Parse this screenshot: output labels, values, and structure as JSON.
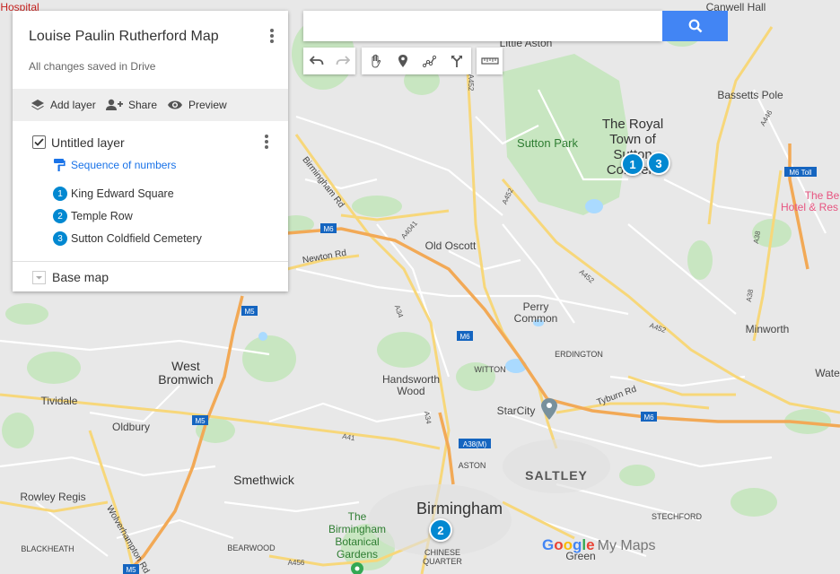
{
  "panel": {
    "title": "Louise Paulin Rutherford Map",
    "subtitle": "All changes saved in Drive",
    "actions": {
      "add_layer": "Add layer",
      "share": "Share",
      "preview": "Preview"
    },
    "layer": {
      "name": "Untitled layer",
      "checked": true,
      "style": "Sequence of numbers",
      "places": [
        {
          "num": "1",
          "name": "King Edward Square"
        },
        {
          "num": "2",
          "name": "Temple Row"
        },
        {
          "num": "3",
          "name": "Sutton Coldfield Cemetery"
        }
      ]
    },
    "basemap": "Base map"
  },
  "search": {
    "value": "",
    "placeholder": ""
  },
  "toolbar": [
    "undo-icon",
    "redo-icon",
    "hand-icon",
    "add-marker-icon",
    "draw-line-icon",
    "directions-icon",
    "ruler-icon"
  ],
  "accent_color": "#0288d1",
  "search_color": "#4285f4",
  "map_labels": {
    "hospital": "Hospital",
    "canwell": "Canwell Hall",
    "little_aston": "Little Aston",
    "bassetts_pole": "Bassetts Pole",
    "royal_line1": "The Royal",
    "royal_line2": "Town of",
    "royal_line3": "Sutton",
    "royal_line4": "Coldfield",
    "sutton_park": "Sutton Park",
    "old_oscott": "Old Oscott",
    "perry_line1": "Perry",
    "perry_line2": "Common",
    "erdington": "ERDINGTON",
    "minworth": "Minworth",
    "west_bromwich_1": "West",
    "west_bromwich_2": "Bromwich",
    "tividale": "Tividale",
    "oldbury": "Oldbury",
    "handsworth_1": "Handsworth",
    "handsworth_2": "Wood",
    "witton": "WITTON",
    "starcity": "StarCity",
    "saltley": "SALTLEY",
    "aston": "ASTON",
    "smethwick": "Smethwick",
    "rowley": "Rowley Regis",
    "blackheath": "BLACKHEATH",
    "birmingham": "Birmingham",
    "botanical_1": "The",
    "botanical_2": "Birmingham",
    "botanical_3": "Botanical",
    "botanical_4": "Gardens",
    "bearwood": "BEARWOOD",
    "chinese_1": "CHINESE",
    "chinese_2": "QUARTER",
    "stechford": "STECHFORD",
    "hotel_1": "The Be",
    "hotel_2": "Hotel & Res",
    "water": "Wate",
    "birmingham_rd": "Birmingham Rd",
    "newton_rd": "Newton Rd",
    "tyburn_rd": "Tyburn Rd",
    "wolverhampton_rd": "Wolverhampton Rd",
    "gardens_green": "Green"
  },
  "road_shields": {
    "a452": "A452",
    "a452b": "A452",
    "a452c": "A452",
    "a452d": "A452",
    "a446": "A446",
    "m6toll": "M6 Toll",
    "a38": "A38",
    "a38b": "A38",
    "m6a": "M6",
    "m6b": "M6",
    "m6c": "M6",
    "a4041": "A4041",
    "a34": "A34",
    "a34b": "A34",
    "m5a": "M5",
    "m5b": "M5",
    "m5c": "M5",
    "a41": "A41",
    "a38m": "A38(M)",
    "a456": "A456"
  },
  "map_pins": [
    {
      "num": "1"
    },
    {
      "num": "2"
    },
    {
      "num": "3"
    }
  ],
  "branding": {
    "google": "Google",
    "my_maps": "My Maps"
  }
}
